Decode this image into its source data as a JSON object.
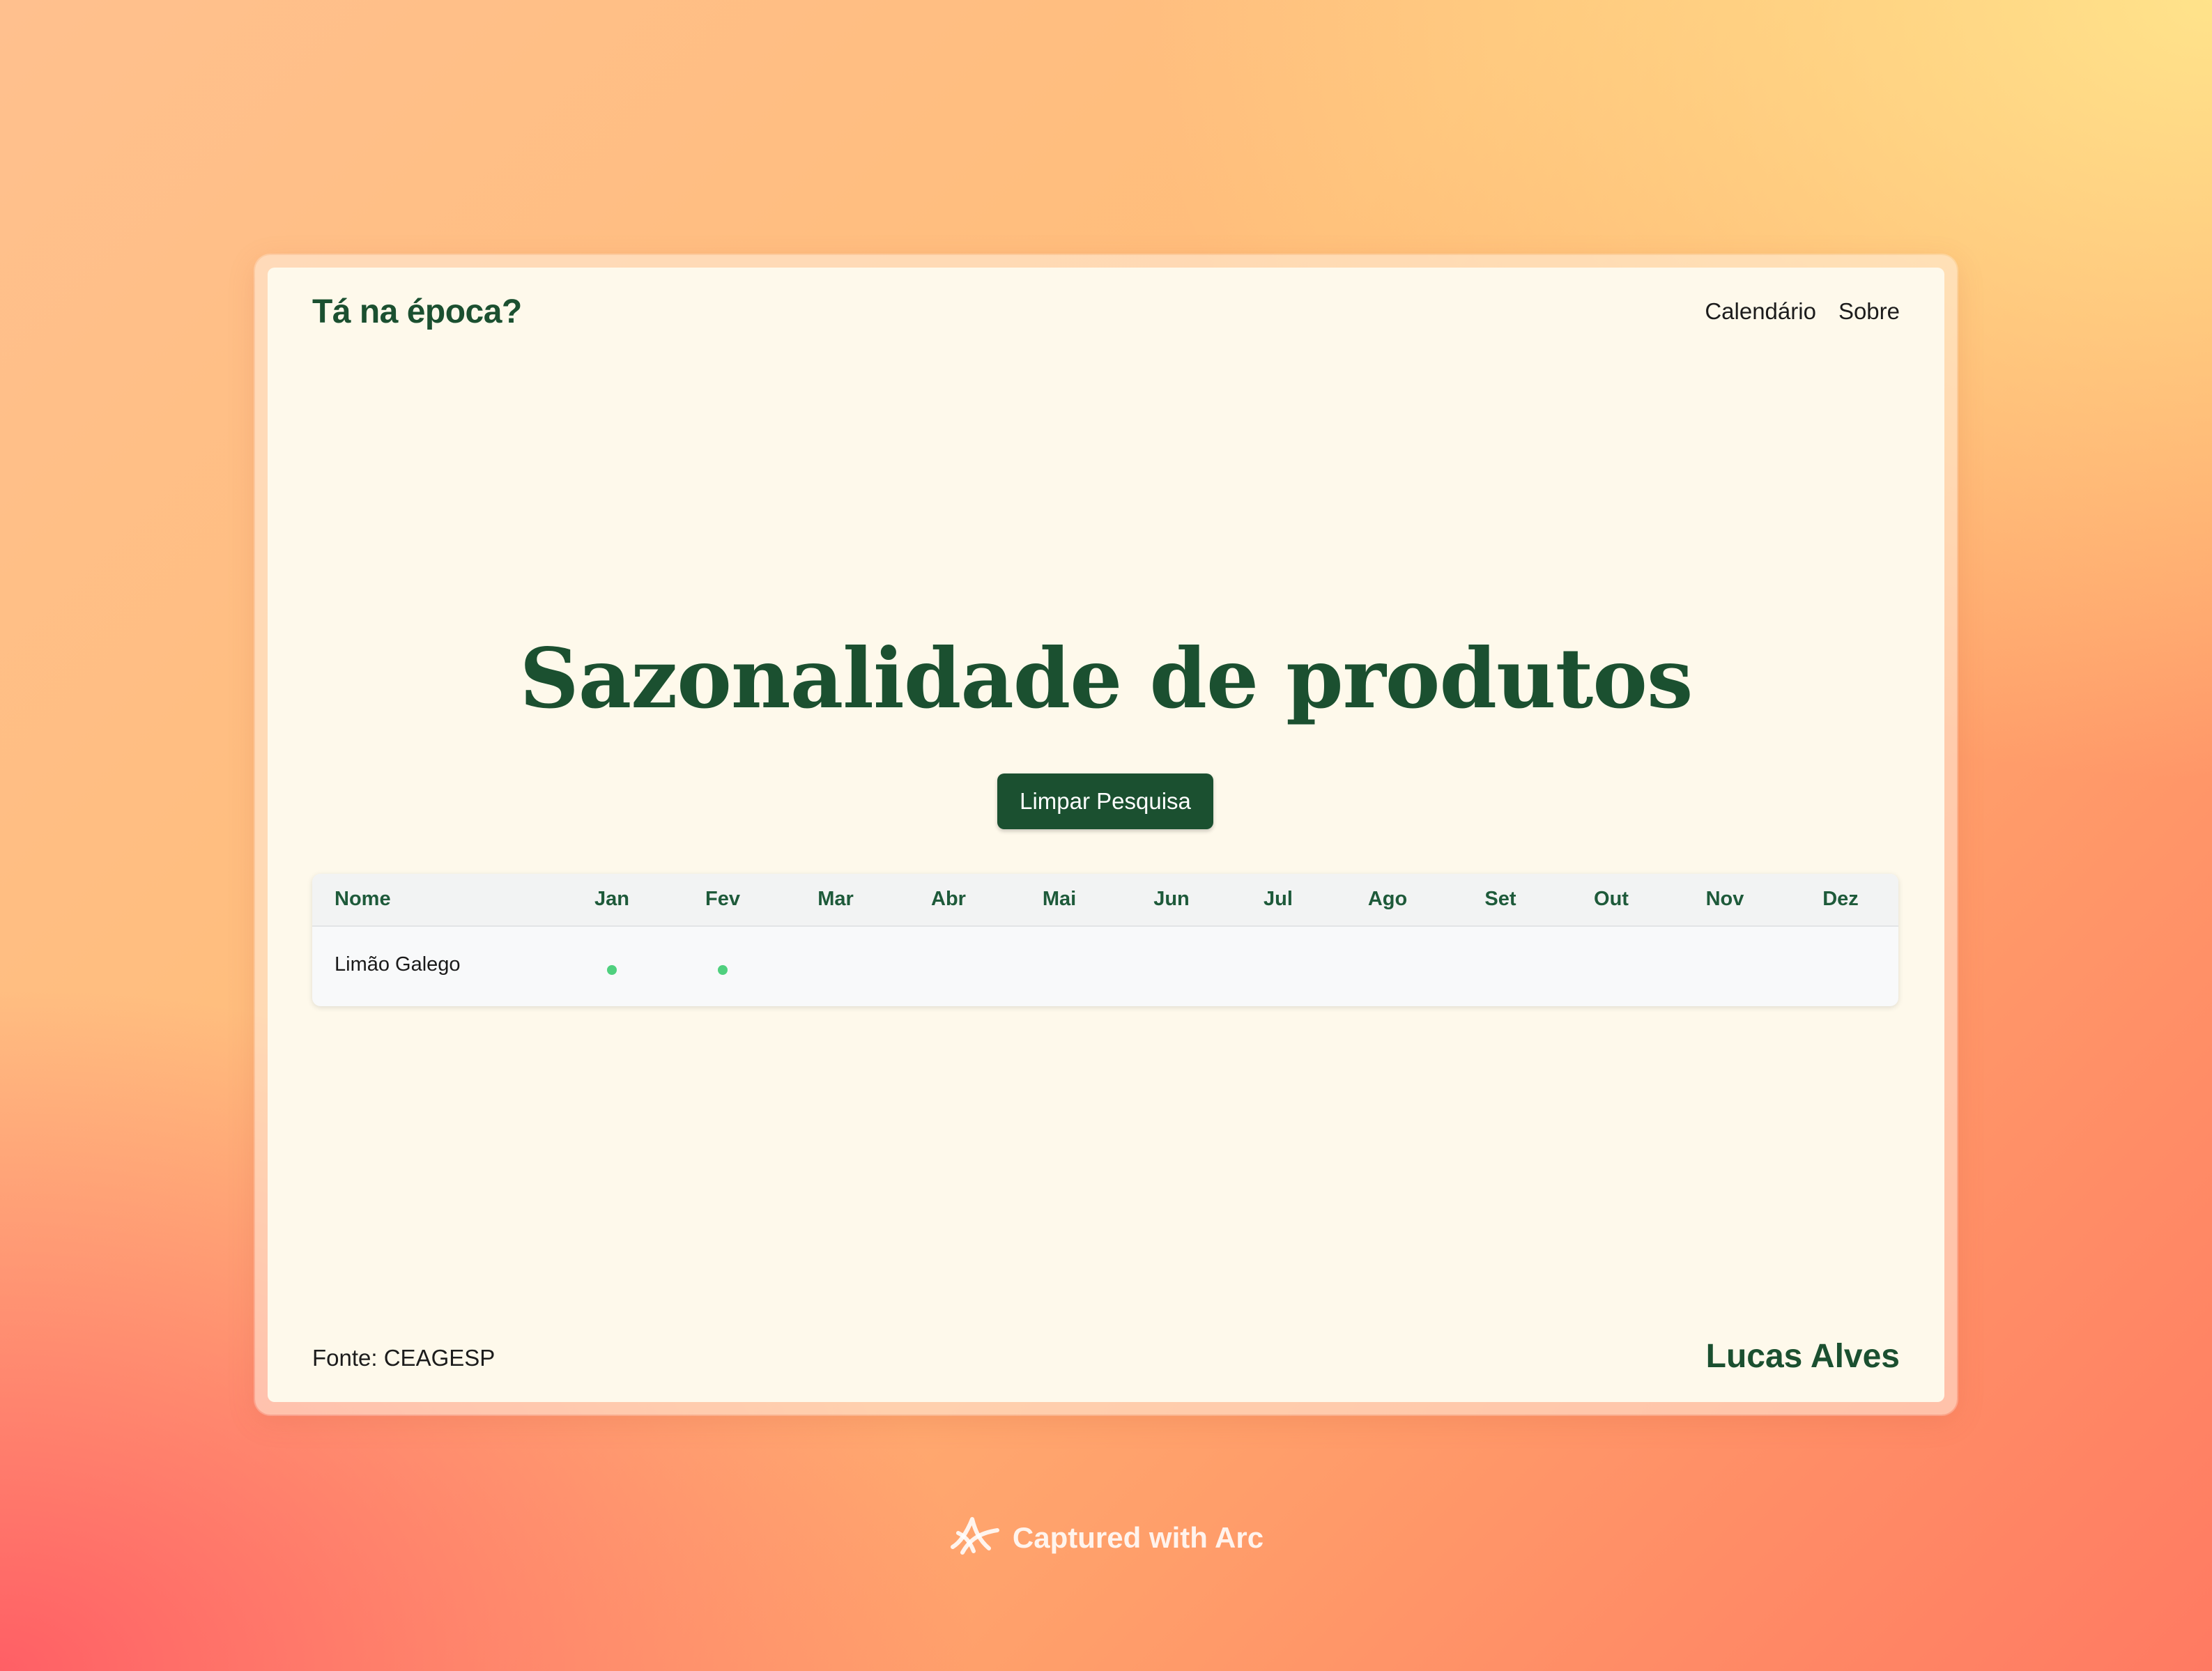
{
  "header": {
    "brand": "Tá na época?",
    "nav": [
      {
        "label": "Calendário"
      },
      {
        "label": "Sobre"
      }
    ]
  },
  "main": {
    "title": "Sazonalidade de produtos",
    "clear_button_label": "Limpar Pesquisa"
  },
  "table": {
    "name_header": "Nome",
    "months": [
      "Jan",
      "Fev",
      "Mar",
      "Abr",
      "Mai",
      "Jun",
      "Jul",
      "Ago",
      "Set",
      "Out",
      "Nov",
      "Dez"
    ],
    "rows": [
      {
        "name": "Limão Galego",
        "in_season": [
          true,
          true,
          false,
          false,
          false,
          false,
          false,
          false,
          false,
          false,
          false,
          false
        ]
      }
    ]
  },
  "footer": {
    "source": "Fonte: CEAGESP",
    "author": "Lucas Alves"
  },
  "badge": {
    "label": "Captured with Arc",
    "icon": "arc-logo-icon"
  },
  "colors": {
    "brand_green": "#1b5030",
    "season_dot": "#4fd07e",
    "page_bg": "#fef9eb"
  }
}
